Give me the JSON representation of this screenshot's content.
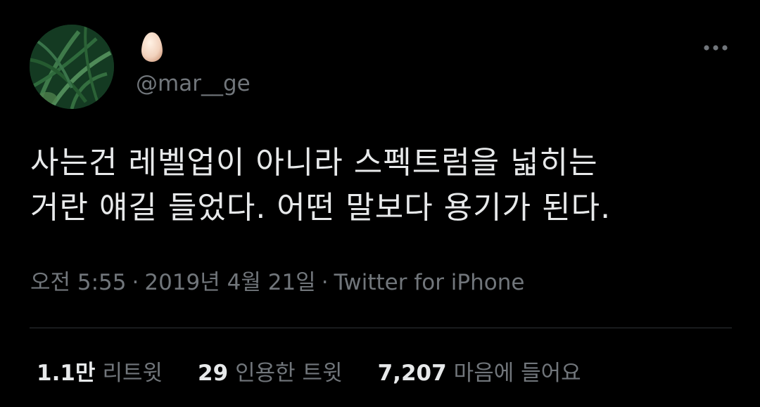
{
  "author": {
    "display_name_icon": "egg-emoji",
    "handle": "@mar__ge"
  },
  "tweet": {
    "text": "사는건 레벨업이 아니라 스펙트럼을 넓히는\n거란 얘길 들었다. 어떤 말보다 용기가 된다."
  },
  "meta": {
    "time": "오전 5:55",
    "separator": "·",
    "date": "2019년 4월 21일",
    "source": "Twitter for iPhone"
  },
  "stats": {
    "retweets_count": "1.1만",
    "retweets_label": "리트윗",
    "quotes_count": "29",
    "quotes_label": "인용한 트윗",
    "likes_count": "7,207",
    "likes_label": "마음에 들어요"
  },
  "colors": {
    "background": "#000000",
    "text_primary": "#e7e9ea",
    "text_secondary": "#71767b",
    "divider": "#2f3336"
  }
}
